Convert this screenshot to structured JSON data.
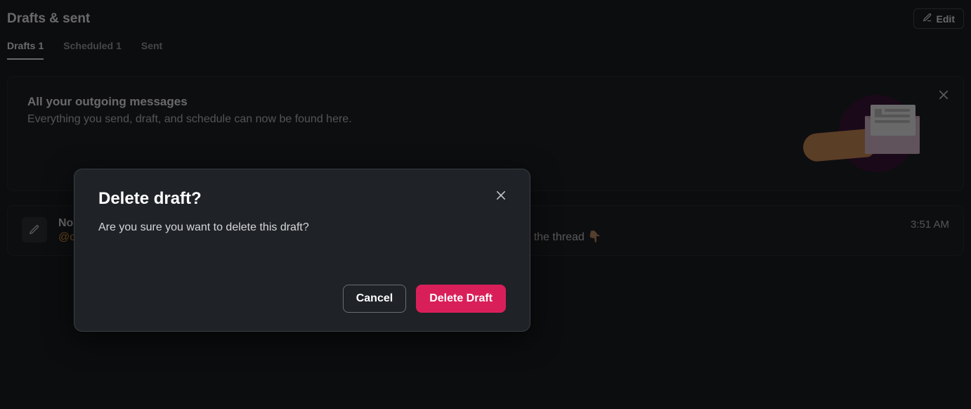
{
  "header": {
    "title": "Drafts & sent",
    "edit_label": "Edit"
  },
  "tabs": [
    {
      "label": "Drafts",
      "count": "1",
      "active": true
    },
    {
      "label": "Scheduled",
      "count": "1",
      "active": false
    },
    {
      "label": "Sent",
      "count": "",
      "active": false
    }
  ],
  "banner": {
    "title": "All your outgoing messages",
    "subtitle": "Everything you send, draft, and schedule can now be found here."
  },
  "draft": {
    "title_prefix": "No",
    "mention": "@cl",
    "trailing_text": "the thread 👇🏽",
    "time": "3:51 AM"
  },
  "modal": {
    "title": "Delete draft?",
    "body": "Are you sure you want to delete this draft?",
    "cancel_label": "Cancel",
    "confirm_label": "Delete Draft"
  }
}
